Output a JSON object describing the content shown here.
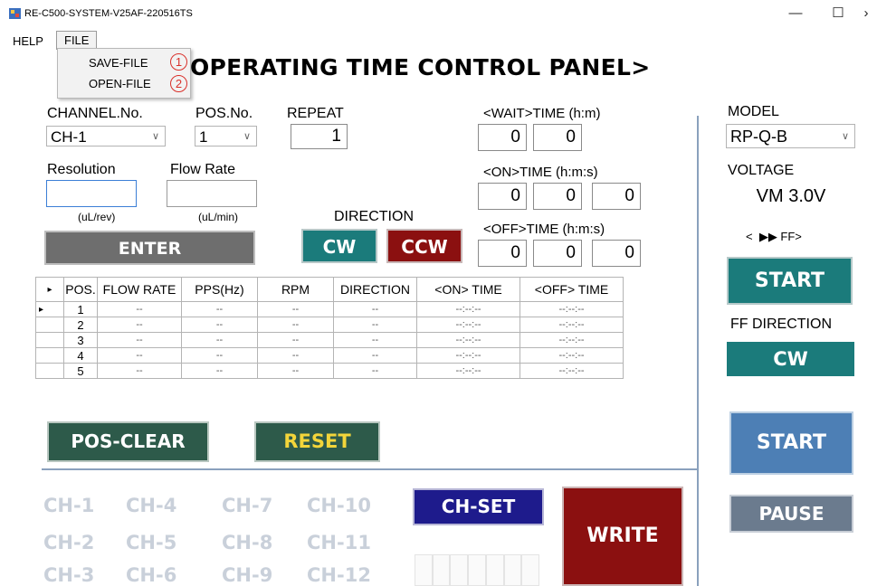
{
  "window": {
    "title": "RE-C500-SYSTEM-V25AF-220516TS",
    "minimize": "—",
    "maximize": "☐",
    "close": "›"
  },
  "menu": {
    "help": "HELP",
    "file": "FILE",
    "file_items": [
      {
        "label": "SAVE-FILE",
        "marker": "1"
      },
      {
        "label": "OPEN-FILE",
        "marker": "2"
      }
    ]
  },
  "heading": "OPERATING TIME  CONTROL PANEL>",
  "channel": {
    "label": "CHANNEL.No.",
    "value": "CH-1"
  },
  "pos": {
    "label": "POS.No.",
    "value": "1"
  },
  "repeat": {
    "label": "REPEAT",
    "value": "1"
  },
  "wait_time": {
    "label": "<WAIT>TIME (h:m)",
    "h": "0",
    "m": "0"
  },
  "on_time": {
    "label": "<ON>TIME (h:m:s)",
    "h": "0",
    "m": "0",
    "s": "0"
  },
  "off_time": {
    "label": "<OFF>TIME (h:m:s)",
    "h": "0",
    "m": "0",
    "s": "0"
  },
  "resolution": {
    "label": "Resolution",
    "unit": "(uL/rev)",
    "value": ""
  },
  "flow_rate": {
    "label": "Flow Rate",
    "unit": "(uL/min)",
    "value": ""
  },
  "direction": {
    "label": "DIRECTION",
    "cw": "CW",
    "ccw": "CCW"
  },
  "enter_button": "ENTER",
  "table": {
    "row_indicator": "▸",
    "columns": [
      "POS.",
      "FLOW RATE",
      "PPS(Hz)",
      "RPM",
      "DIRECTION",
      "<ON> TIME",
      "<OFF> TIME"
    ],
    "rows": [
      [
        "1",
        "--",
        "--",
        "--",
        "--",
        "--:--:--",
        "--:--:--"
      ],
      [
        "2",
        "--",
        "--",
        "--",
        "--",
        "--:--:--",
        "--:--:--"
      ],
      [
        "3",
        "--",
        "--",
        "--",
        "--",
        "--:--:--",
        "--:--:--"
      ],
      [
        "4",
        "--",
        "--",
        "--",
        "--",
        "--:--:--",
        "--:--:--"
      ],
      [
        "5",
        "--",
        "--",
        "--",
        "--",
        "--:--:--",
        "--:--:--"
      ]
    ]
  },
  "pos_clear_button": "POS-CLEAR",
  "reset_button": "RESET",
  "channels": [
    "CH-1",
    "CH-4",
    "CH-7",
    "CH-10",
    "CH-2",
    "CH-5",
    "CH-8",
    "CH-11",
    "CH-3",
    "CH-6",
    "CH-9",
    "CH-12"
  ],
  "ch_set_button": "CH-SET",
  "write_button": "WRITE",
  "model": {
    "label": "MODEL",
    "value": "RP-Q-B"
  },
  "voltage": {
    "label": "VOLTAGE",
    "value": "VM 3.0V"
  },
  "ff_indicator": "<  ▶▶ FF>",
  "ff_start_button": "START",
  "ff_direction": {
    "label": "FF DIRECTION",
    "value": "CW"
  },
  "start_button": "START",
  "pause_button": "PAUSE",
  "colors": {
    "teal": "#1b7b7b",
    "crimson": "#8b1010",
    "dark_green": "#2d5a4a",
    "navy": "#1e1b8c",
    "blue": "#4d7fb5",
    "gray": "#6b7b8e",
    "reset_text": "#f3d53a"
  }
}
